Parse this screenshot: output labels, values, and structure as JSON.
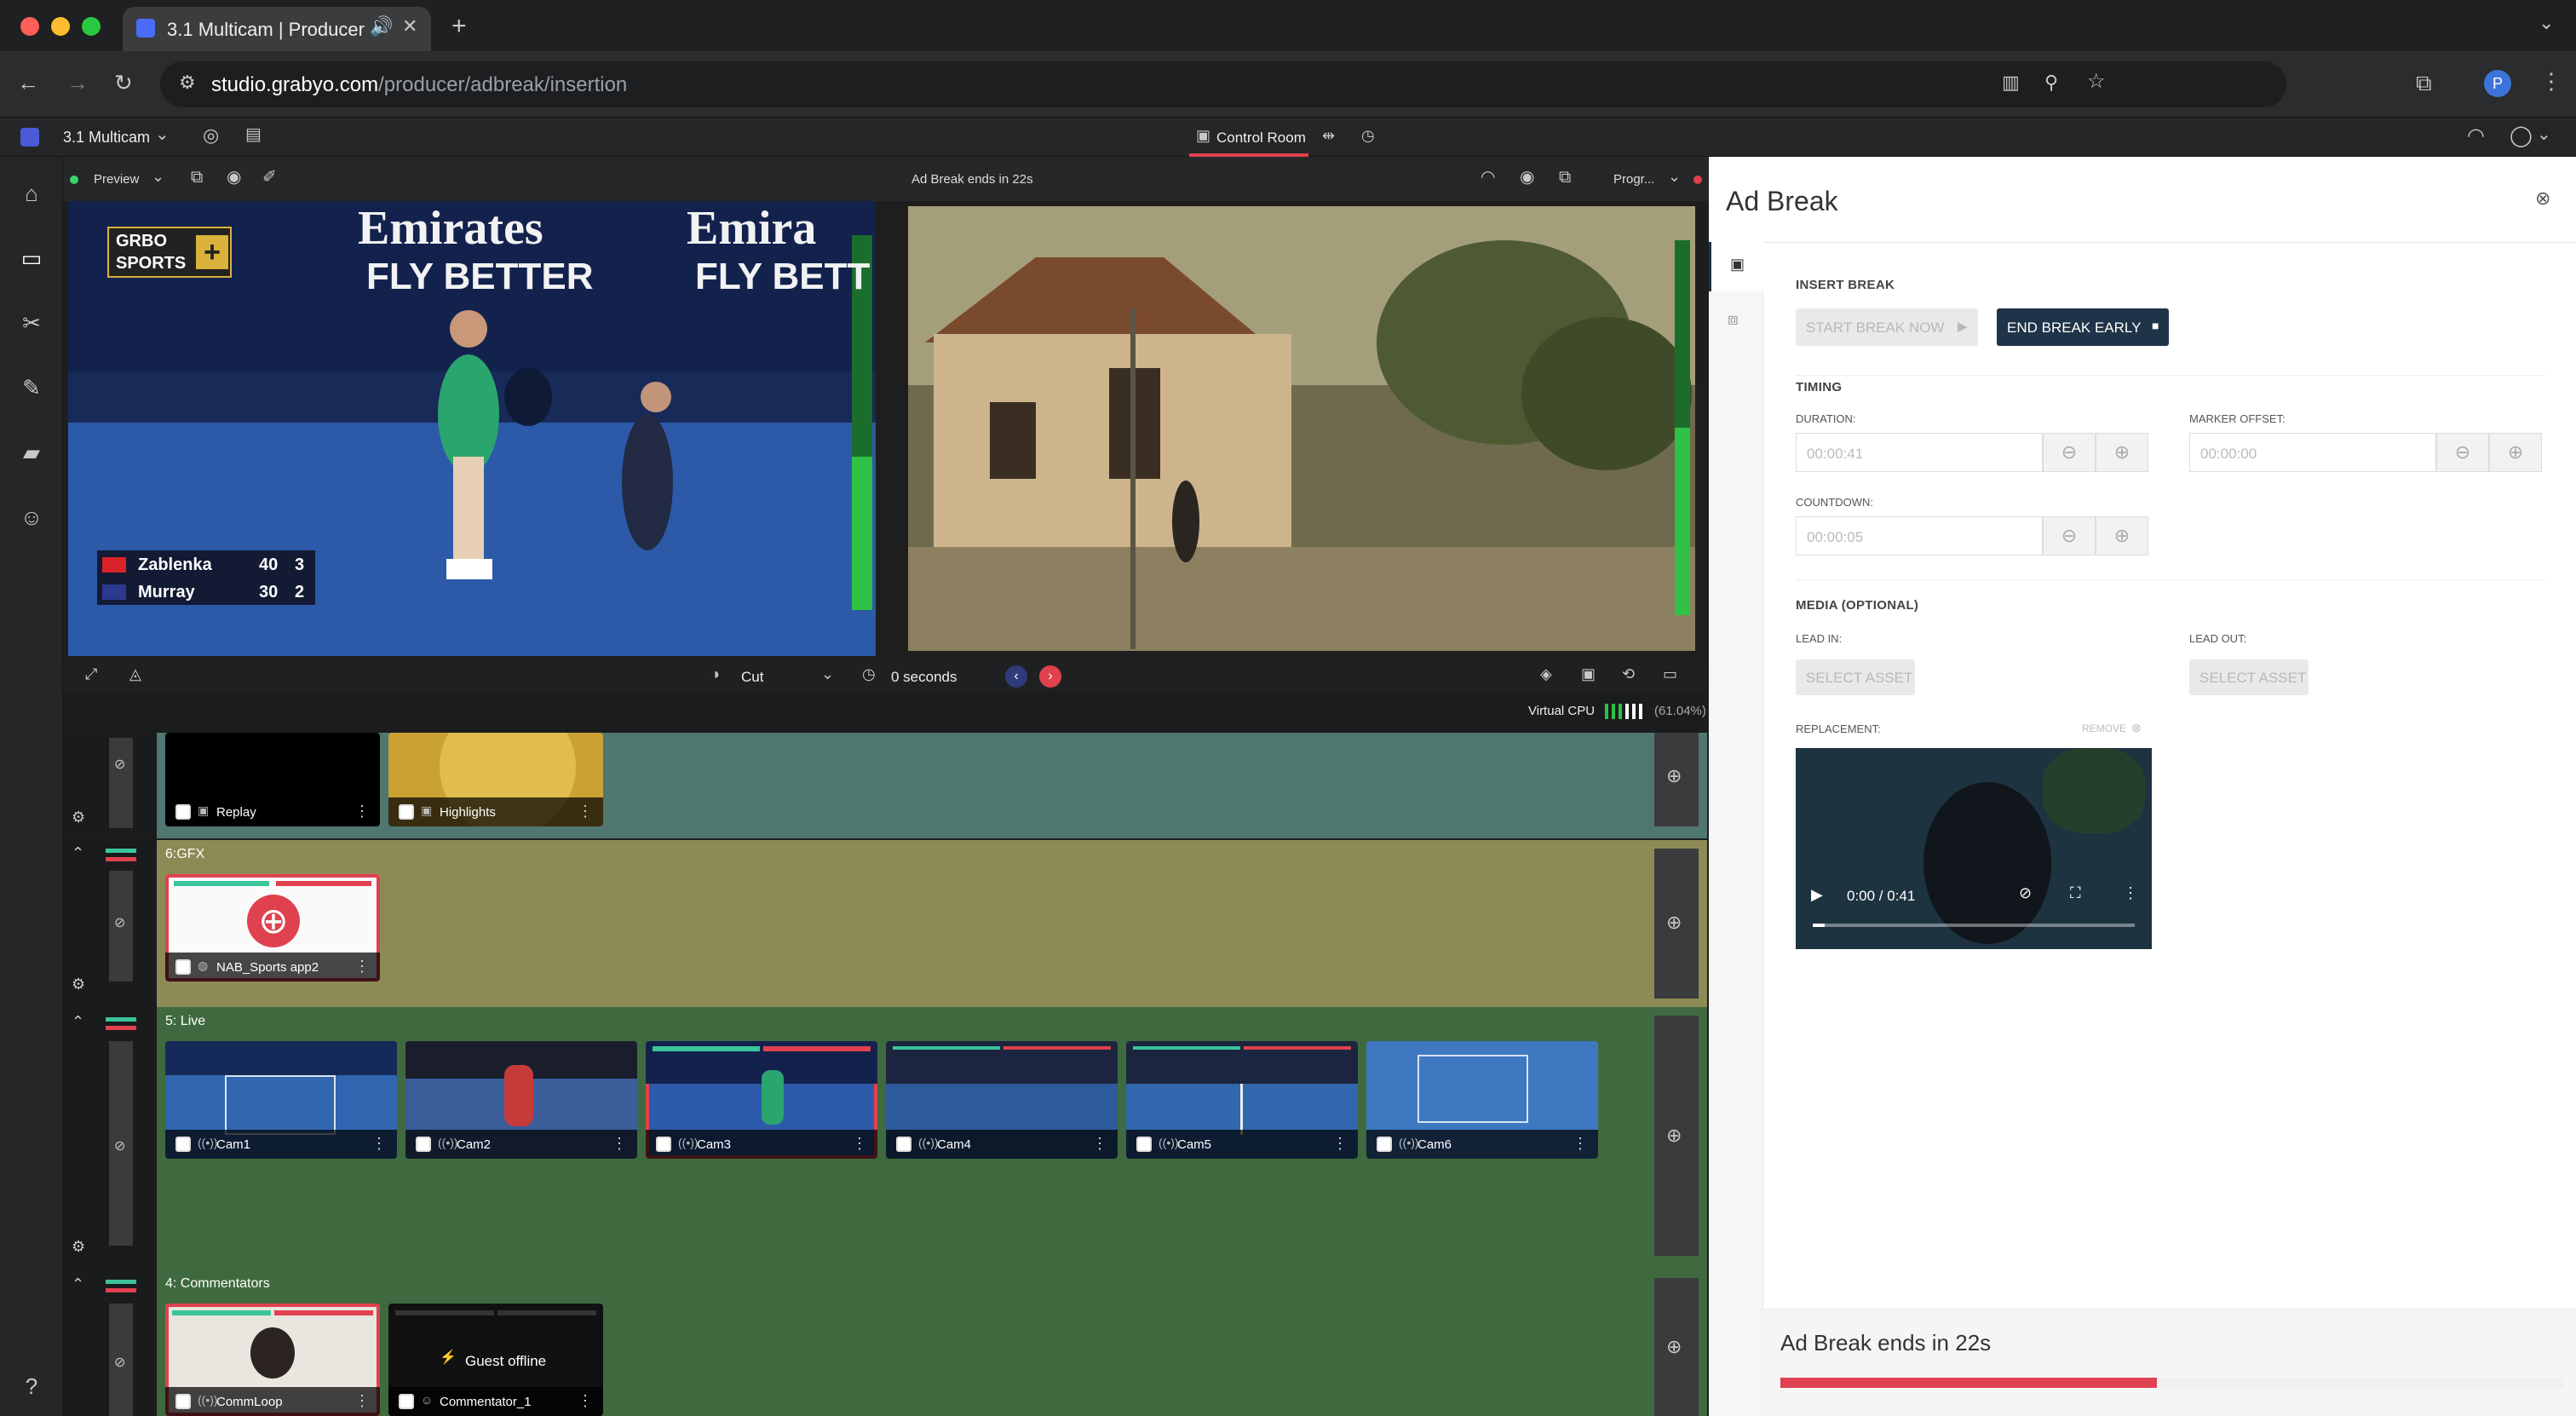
{
  "browser": {
    "tab_title": "3.1 Multicam | Producer",
    "url_host": "studio.grabyo.com",
    "url_path": "/producer/adbreak/insertion",
    "profile_letter": "P"
  },
  "app": {
    "project_name": "3.1 Multicam",
    "control_room_label": "Control Room"
  },
  "preview": {
    "mode_label": "Preview",
    "program_status": "Ad Break ends in 22s",
    "program_label": "Progr...",
    "transition_label": "Cut",
    "duration_label": "0 seconds",
    "cpu_label": "Virtual CPU",
    "cpu_percent": "(61.04%)",
    "logo_top": "GRBO",
    "logo_bottom": "SPORTS",
    "banner_top_1": "Emirates",
    "banner_bot_1": "FLY BETTER",
    "banner_top_2": "Emira",
    "banner_bot_2": "FLY BETT",
    "scoreboard": [
      {
        "name": "Zablenka",
        "points": "40",
        "games": "3"
      },
      {
        "name": "Murray",
        "points": "30",
        "games": "2"
      }
    ]
  },
  "layers": [
    {
      "title": "",
      "sources": [
        {
          "name": "Replay"
        },
        {
          "name": "Highlights"
        }
      ]
    },
    {
      "title": "6:GFX",
      "sources": [
        {
          "name": "NAB_Sports app2"
        }
      ]
    },
    {
      "title": "5: Live",
      "sources": [
        {
          "name": "Cam1"
        },
        {
          "name": "Cam2"
        },
        {
          "name": "Cam3"
        },
        {
          "name": "Cam4"
        },
        {
          "name": "Cam5"
        },
        {
          "name": "Cam6"
        }
      ]
    },
    {
      "title": "4: Commentators",
      "sources": [
        {
          "name": "CommLoop"
        },
        {
          "name": "Commentator_1",
          "status": "Guest offline"
        }
      ]
    }
  ],
  "ad_break": {
    "title": "Ad Break",
    "insert_section": "INSERT BREAK",
    "start_button": "START BREAK NOW",
    "end_button": "END BREAK EARLY",
    "timing_section": "TIMING",
    "duration_label": "DURATION:",
    "duration_value": "00:00:41",
    "marker_label": "MARKER OFFSET:",
    "marker_value": "00:00:00",
    "countdown_label": "COUNTDOWN:",
    "countdown_value": "00:00:05",
    "media_section": "MEDIA (OPTIONAL)",
    "lead_in_label": "LEAD IN:",
    "lead_out_label": "LEAD OUT:",
    "select_asset_label": "SELECT ASSET",
    "replacement_label": "REPLACEMENT:",
    "remove_label": "REMOVE",
    "player_time": "0:00 / 0:41",
    "footer_status": "Ad Break ends in 22s",
    "progress_fraction": 0.48
  },
  "colors": {
    "accent_red": "#e0414e",
    "panel_dark_button": "#1f3448",
    "layer_teal": "#4f7770",
    "layer_olive": "#8d8a55",
    "layer_green": "#3f6a3f"
  }
}
